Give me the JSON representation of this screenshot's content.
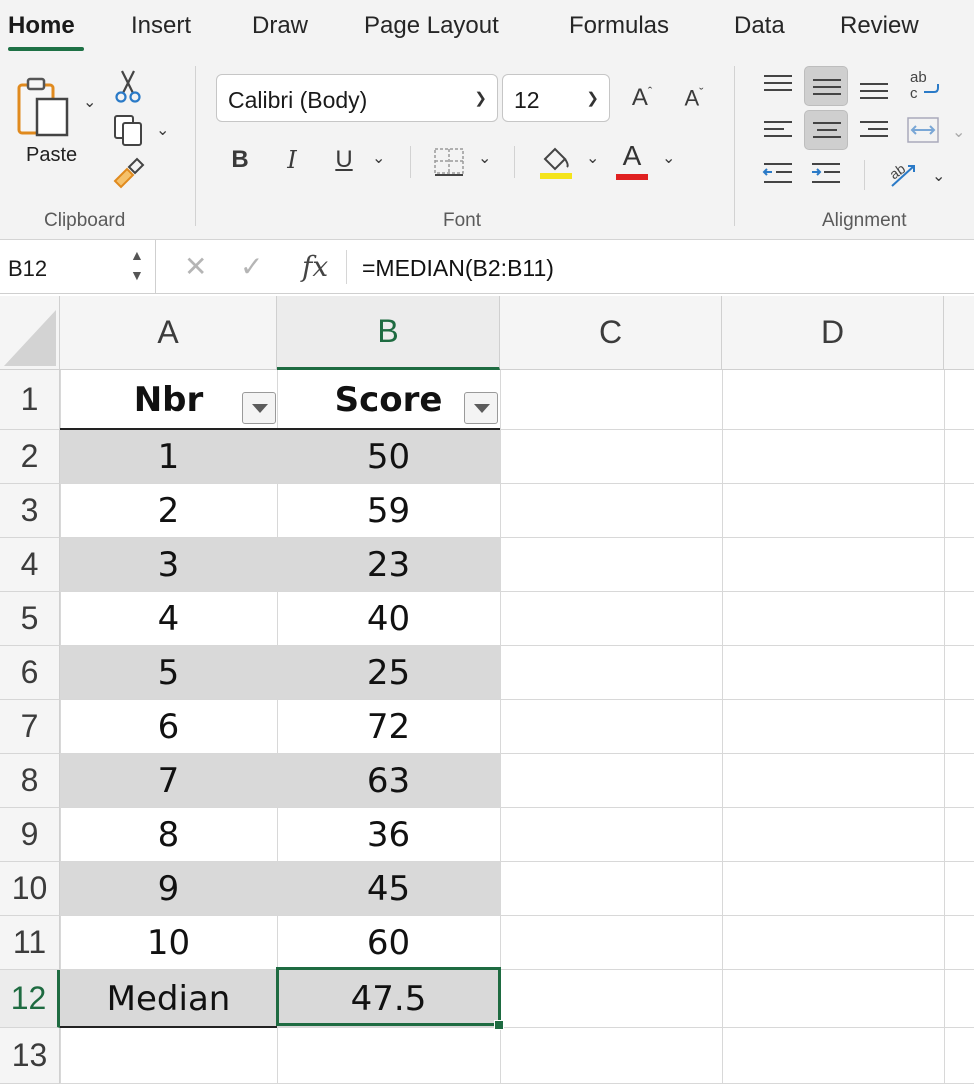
{
  "ribbon": {
    "tabs": [
      {
        "label": "Home",
        "active": true
      },
      {
        "label": "Insert",
        "active": false
      },
      {
        "label": "Draw",
        "active": false
      },
      {
        "label": "Page Layout",
        "active": false
      },
      {
        "label": "Formulas",
        "active": false
      },
      {
        "label": "Data",
        "active": false
      },
      {
        "label": "Review",
        "active": false
      }
    ],
    "clipboard": {
      "paste_label": "Paste",
      "group_label": "Clipboard"
    },
    "font": {
      "family": "Calibri (Body)",
      "size": "12",
      "group_label": "Font",
      "bold": "B",
      "italic": "I",
      "underline": "U",
      "font_color_glyph": "A",
      "highlight_color": "#f4e41a",
      "font_color": "#e02020"
    },
    "alignment": {
      "group_label": "Alignment"
    }
  },
  "formula_bar": {
    "name_box": "B12",
    "fx": "fx",
    "formula": "=MEDIAN(B2:B11)"
  },
  "sheet": {
    "columns": [
      "A",
      "B",
      "C",
      "D"
    ],
    "selected_column": "B",
    "selected_row": "12",
    "headers": [
      "Nbr",
      "Score"
    ],
    "rows": [
      {
        "num": "1"
      },
      {
        "num": "2",
        "a": "1",
        "b": "50"
      },
      {
        "num": "3",
        "a": "2",
        "b": "59"
      },
      {
        "num": "4",
        "a": "3",
        "b": "23"
      },
      {
        "num": "5",
        "a": "4",
        "b": "40"
      },
      {
        "num": "6",
        "a": "5",
        "b": "25"
      },
      {
        "num": "7",
        "a": "6",
        "b": "72"
      },
      {
        "num": "8",
        "a": "7",
        "b": "63"
      },
      {
        "num": "9",
        "a": "8",
        "b": "36"
      },
      {
        "num": "10",
        "a": "9",
        "b": "45"
      },
      {
        "num": "11",
        "a": "10",
        "b": "60"
      },
      {
        "num": "12",
        "a": "Median",
        "b": "47.5"
      },
      {
        "num": "13"
      }
    ]
  }
}
